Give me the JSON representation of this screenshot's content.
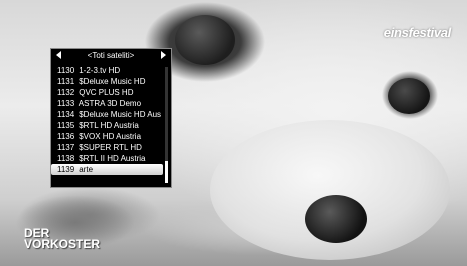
{
  "overlay": {
    "channel_logo": "einsfestival",
    "show_logo_line1": "DER",
    "show_logo_line2": "VORKOSTER"
  },
  "osd": {
    "title": "<Toti sateliti>",
    "channels": [
      {
        "number": "1130",
        "name": "1-2-3.tv HD"
      },
      {
        "number": "1131",
        "name": "$Deluxe Music HD"
      },
      {
        "number": "1132",
        "name": "QVC PLUS HD"
      },
      {
        "number": "1133",
        "name": "ASTRA 3D Demo"
      },
      {
        "number": "1134",
        "name": "$Deluxe Music HD Aus"
      },
      {
        "number": "1135",
        "name": "$RTL HD Austria"
      },
      {
        "number": "1136",
        "name": "$VOX HD Austria"
      },
      {
        "number": "1137",
        "name": "$SUPER RTL HD"
      },
      {
        "number": "1138",
        "name": "$RTL II HD Austria"
      },
      {
        "number": "1139",
        "name": "arte"
      }
    ],
    "selected_index": 9,
    "colors": {
      "background": "#000000",
      "text": "#ffffff",
      "highlight": "#ffffff"
    }
  }
}
